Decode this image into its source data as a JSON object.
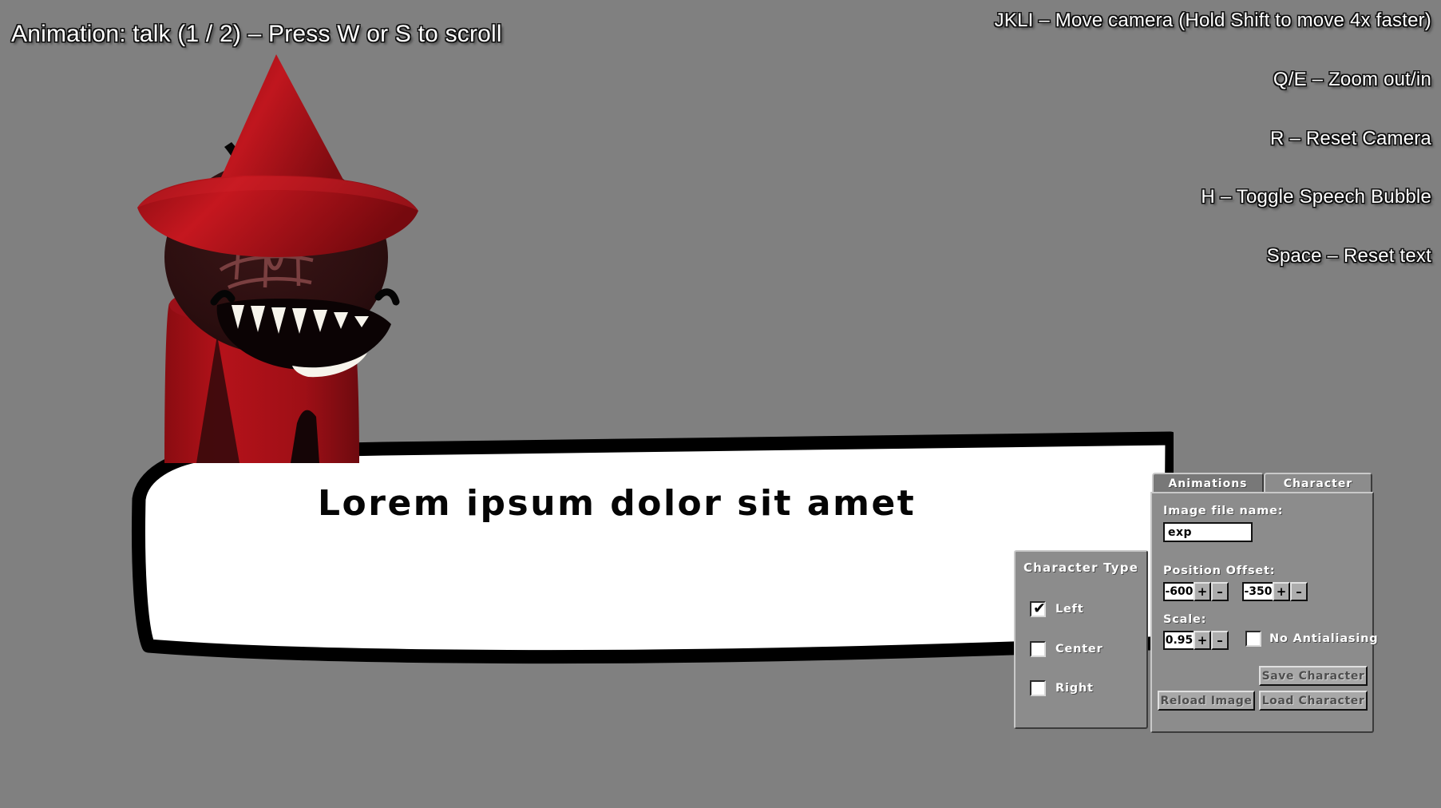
{
  "viewport": {
    "background_color": "#808080"
  },
  "hud": {
    "animation_status": "Animation: talk (1 / 2) – Press W or S to scroll",
    "help": [
      "JKLI – Move camera (Hold Shift to move 4x faster)",
      "Q/E – Zoom out/in",
      "R – Reset Camera",
      "H – Toggle Speech Bubble",
      "Space – Reset text"
    ]
  },
  "speech_bubble": {
    "text": "Lorem ipsum dolor sit amet",
    "fill_color": "#ffffff",
    "outline_color": "#000000"
  },
  "character_sprite": {
    "name": "red-robed-hat-creature",
    "robe_color": "#a50f16",
    "robe_shadow_color": "#3a0a0c",
    "hat_color": "#b8131b",
    "face_color": "#2e0f10",
    "teeth_color": "#f5f2ea",
    "sigil_color": "#7a4040"
  },
  "tabs": [
    {
      "label": "Animations",
      "active": false
    },
    {
      "label": "Character",
      "active": true
    }
  ],
  "character_panel": {
    "image_file_name_label": "Image file name:",
    "image_file_name_value": "exp",
    "position_offset_label": "Position Offset:",
    "position_offset_x": "-600",
    "position_offset_y": "-350",
    "scale_label": "Scale:",
    "scale_value": "0.95",
    "plus_label": "+",
    "minus_label": "–",
    "no_antialiasing_label": "No Antialiasing",
    "no_antialiasing_checked": false,
    "save_character_label": "Save Character",
    "load_character_label": "Load Character",
    "reload_image_label": "Reload Image"
  },
  "character_type_panel": {
    "title": "Character Type",
    "options": [
      {
        "label": "Left",
        "checked": true,
        "tick": "✔"
      },
      {
        "label": "Center",
        "checked": false,
        "tick": ""
      },
      {
        "label": "Right",
        "checked": false,
        "tick": ""
      }
    ]
  }
}
